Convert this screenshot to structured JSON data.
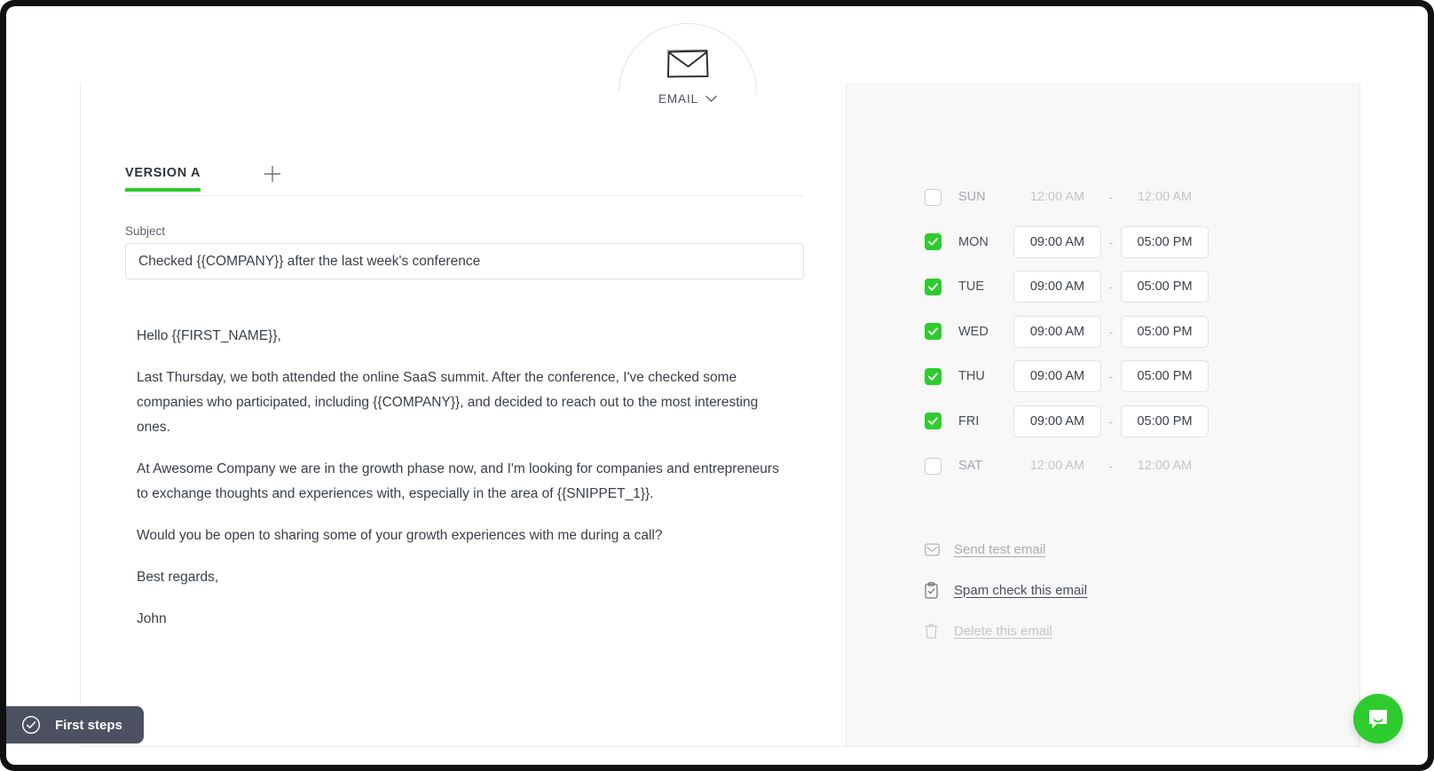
{
  "theme": {
    "accent": "#2ecb2e",
    "panel_bg": "#f8f8f8",
    "text": "#3a4047",
    "muted": "#a9adb3",
    "dark_pill": "#4b5160"
  },
  "channel": {
    "label": "EMAIL",
    "icon": "envelope-icon",
    "chevron": "chevron-down-icon"
  },
  "tabs": {
    "items": [
      {
        "label": "VERSION A",
        "active": true
      }
    ],
    "add_label": "+",
    "add_icon": "plus-icon"
  },
  "subject": {
    "label": "Subject",
    "value": "Checked {{COMPANY}} after the last week's conference",
    "placeholder": "Subject"
  },
  "body": {
    "paragraphs": [
      "Hello {{FIRST_NAME}},",
      "Last Thursday, we both attended the online SaaS summit. After the conference, I've checked some companies who participated, including {{COMPANY}}, and decided to reach out to the most interesting ones.",
      "At Awesome Company we are in the growth phase now, and I'm looking for companies and entrepreneurs to exchange thoughts and experiences with, especially in the area of {{SNIPPET_1}}.",
      "Would you be open to sharing some of your growth experiences with me during a call?",
      "Best regards,",
      "John"
    ]
  },
  "schedule": {
    "separator": "-",
    "rows": [
      {
        "day": "SUN",
        "enabled": false,
        "start": "12:00 AM",
        "end": "12:00 AM"
      },
      {
        "day": "MON",
        "enabled": true,
        "start": "09:00 AM",
        "end": "05:00 PM"
      },
      {
        "day": "TUE",
        "enabled": true,
        "start": "09:00 AM",
        "end": "05:00 PM"
      },
      {
        "day": "WED",
        "enabled": true,
        "start": "09:00 AM",
        "end": "05:00 PM"
      },
      {
        "day": "THU",
        "enabled": true,
        "start": "09:00 AM",
        "end": "05:00 PM"
      },
      {
        "day": "FRI",
        "enabled": true,
        "start": "09:00 AM",
        "end": "05:00 PM"
      },
      {
        "day": "SAT",
        "enabled": false,
        "start": "12:00 AM",
        "end": "12:00 AM"
      }
    ]
  },
  "actions": [
    {
      "label": "Send test email",
      "icon": "envelope-icon",
      "style": "muted"
    },
    {
      "label": "Spam check this email",
      "icon": "clipboard-check-icon",
      "style": "normal"
    },
    {
      "label": "Delete this email",
      "icon": "trash-icon",
      "style": "faint"
    }
  ],
  "first_steps": {
    "label": "First steps",
    "icon": "circle-check-icon"
  },
  "chat": {
    "icon": "chat-bubble-icon"
  }
}
